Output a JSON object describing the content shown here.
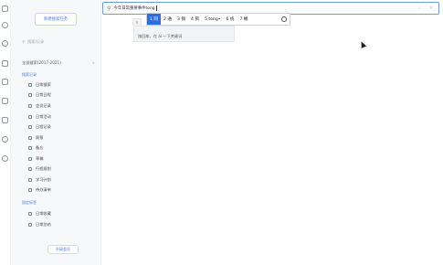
{
  "search": {
    "query": "今年日常重要事件tong"
  },
  "ime": {
    "candidates": [
      "1 同",
      "2 通",
      "3 铜",
      "4 筒",
      "5 tong•",
      "6 统",
      "7 桶"
    ]
  },
  "dropdown": {
    "hint": "按回车，在 ai 一下关键词"
  },
  "sidebar": {
    "new_button": "新建搜索任务",
    "search_placeholder": "搜索/记录",
    "notebook": "全部搜索(2017-2021)",
    "notebook_arrow": "∨",
    "group1": "搜索记录",
    "items": [
      "日常搜索",
      "日常日程",
      "会议记录",
      "日常活动",
      "日程记录",
      "周报",
      "备忘",
      "草稿",
      "行程规划",
      "学习计划",
      "待办清单"
    ],
    "group2": "固定标签",
    "items2": [
      "日常收藏",
      "日常总结"
    ],
    "upgrade": "升级会员"
  },
  "colors": {
    "accent": "#4c7be0",
    "ime_selected": "#2c6fe0"
  }
}
